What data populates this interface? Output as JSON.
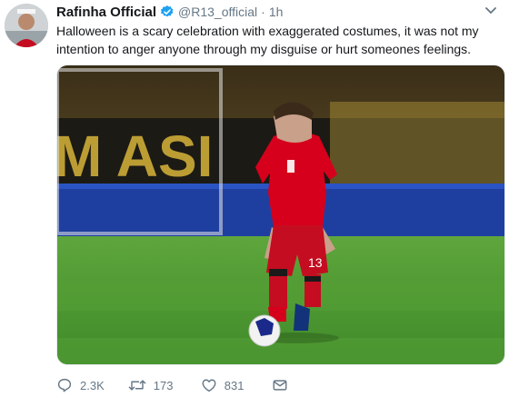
{
  "tweet": {
    "author_name": "Rafinha Official",
    "handle": "@R13_official",
    "separator": "·",
    "time": "1h",
    "text": "Halloween is a scary celebration with exaggerated costumes, it was not my intention to anger anyone through my disguise or hurt someones feelings.",
    "icons": {
      "verified": "verified-badge-icon",
      "more": "chevron-down-icon",
      "reply": "reply-icon",
      "retweet": "retweet-icon",
      "like": "heart-icon",
      "dm": "envelope-icon"
    },
    "media": {
      "player_number": "13",
      "shirt_color": "#d6001c",
      "pitch_color": "#4f9a33"
    },
    "actions": {
      "replies": "2.3K",
      "retweets": "173",
      "likes": "831"
    },
    "colors": {
      "verified": "#1da1f2",
      "muted": "#657786"
    }
  }
}
